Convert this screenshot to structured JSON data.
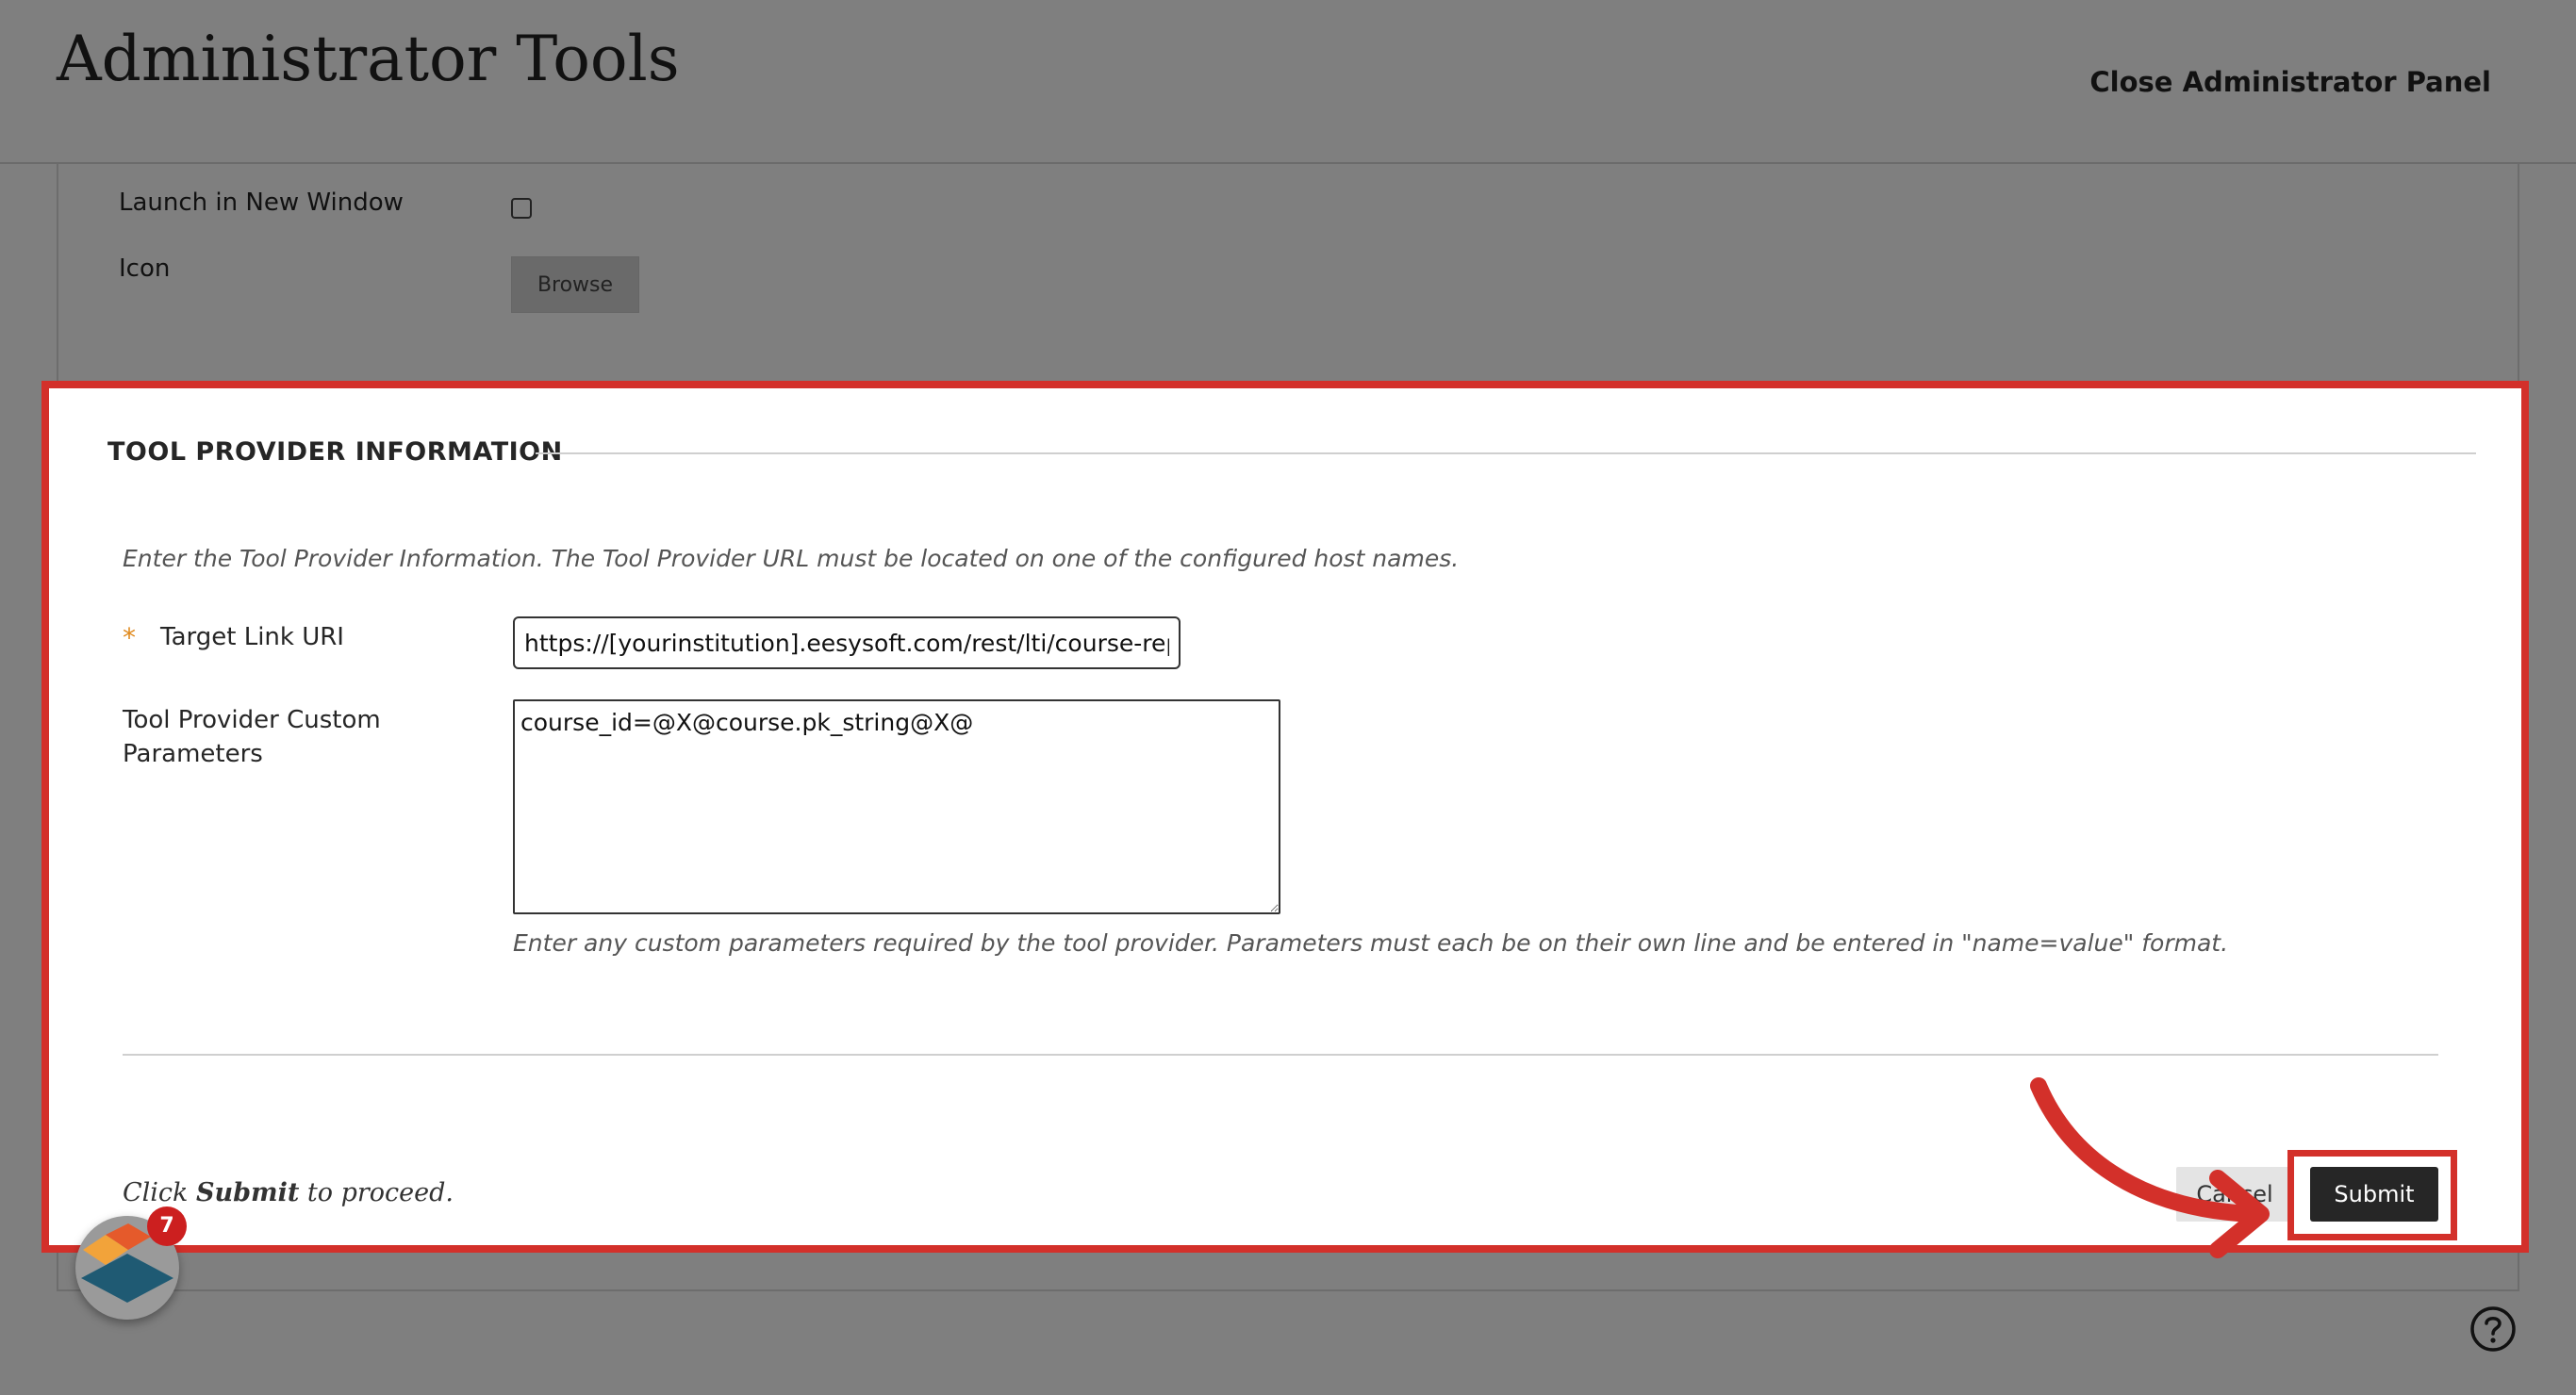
{
  "header": {
    "title": "Administrator Tools",
    "close_label": "Close Administrator Panel"
  },
  "background_form": {
    "launch_label": "Launch in New Window",
    "icon_label": "Icon",
    "browse_label": "Browse"
  },
  "section": {
    "title": "TOOL PROVIDER INFORMATION",
    "instructions": "Enter the Tool Provider Information. The Tool Provider URL must be located on one of the configured host names.",
    "required_mark": "*",
    "target_link_label": "Target Link URI",
    "target_link_value": "https://[yourinstitution].eesysoft.com/rest/lti/course-repo",
    "custom_params_label_line1": "Tool Provider Custom",
    "custom_params_label_line2": "Parameters",
    "custom_params_value": "course_id=@X@course.pk_string@X@",
    "custom_params_help": "Enter any custom parameters required by the tool provider. Parameters must each be on their own line and be entered in \"name=value\" format."
  },
  "footer": {
    "proceed_prefix": "Click ",
    "proceed_emphasis": "Submit",
    "proceed_suffix": " to proceed.",
    "cancel_label": "Cancel",
    "submit_label": "Submit"
  },
  "widget": {
    "badge_count": "7"
  },
  "colors": {
    "highlight": "#d3302a",
    "overlay": "#7f7f7f",
    "required": "#e08a1e",
    "submit_bg": "#262626"
  },
  "icons": [
    "help-circle-icon",
    "eesysoft-logo-icon",
    "annotation-arrow-icon"
  ]
}
